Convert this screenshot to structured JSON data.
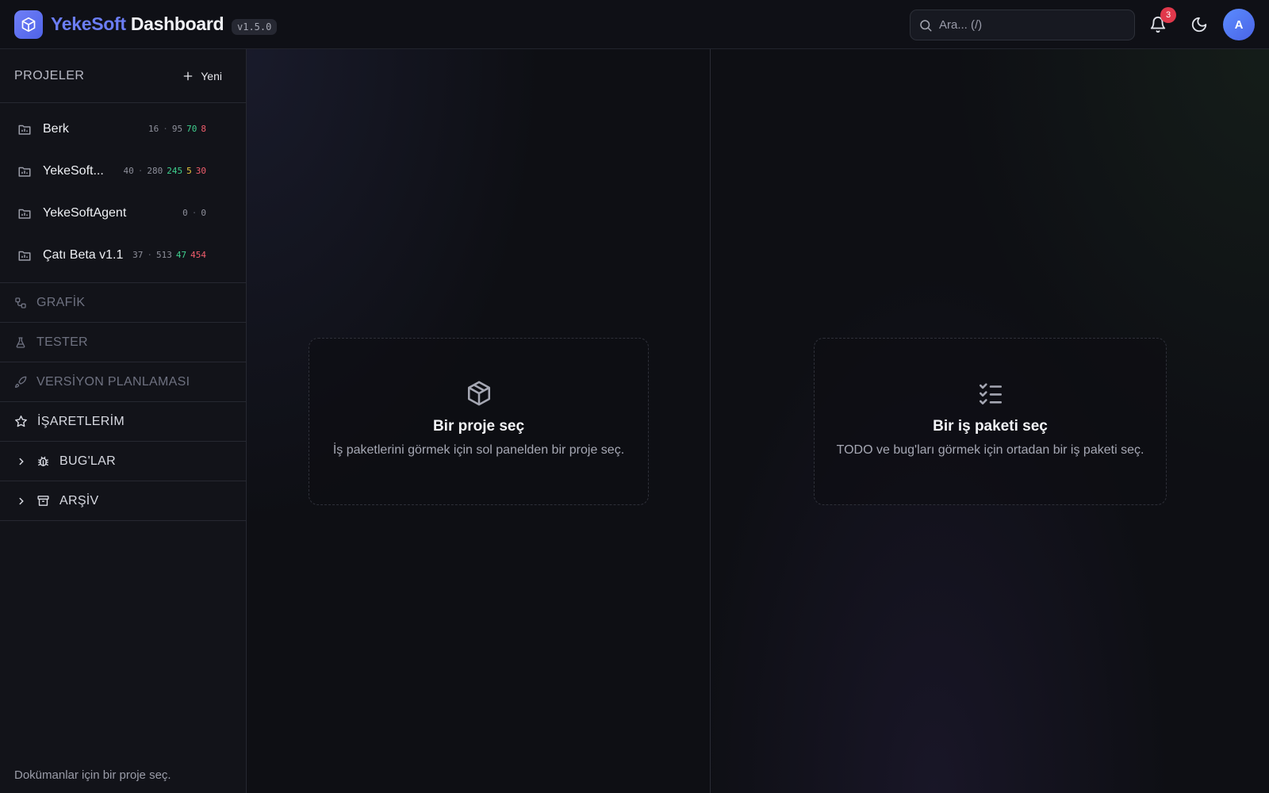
{
  "header": {
    "brand_part1": "YekeSoft",
    "brand_part2": "Dashboard",
    "version": "v1.5.0",
    "search_placeholder": "Ara... (/)",
    "notification_count": "3",
    "avatar_initial": "A"
  },
  "sidebar": {
    "title": "PROJELER",
    "new_label": "Yeni",
    "projects": [
      {
        "name": "Berk",
        "s1": "16",
        "s2": "95",
        "g": "70",
        "y": "",
        "r": "8"
      },
      {
        "name": "YekeSoft...",
        "s1": "40",
        "s2": "280",
        "g": "245",
        "y": "5",
        "r": "30"
      },
      {
        "name": "YekeSoftAgent",
        "s1": "0",
        "s2": "0",
        "g": "",
        "y": "",
        "r": ""
      },
      {
        "name": "Çatı Beta v1.1",
        "s1": "37",
        "s2": "513",
        "g": "47",
        "y": "",
        "r": "454"
      }
    ],
    "sections": {
      "grafik": "GRAFİK",
      "tester": "TESTER",
      "versiyon": "VERSİYON PLANLAMASI",
      "isaretlerim": "İŞARETLERİM",
      "buglar": "BUG'LAR",
      "arsiv": "ARŞİV"
    },
    "doc_note": "Dokümanlar için bir proje seç."
  },
  "main": {
    "project_empty": {
      "title": "Bir proje seç",
      "subtitle": "İş paketlerini görmek için sol panelden bir proje seç."
    },
    "package_empty": {
      "title": "Bir iş paketi seç",
      "subtitle": "TODO ve bug'ları görmek için ortadan bir iş paketi seç."
    }
  },
  "colors": {
    "accent": "#6b7df5",
    "success": "#3fcf8e",
    "warning": "#e7c63c",
    "danger": "#f05d6c"
  }
}
